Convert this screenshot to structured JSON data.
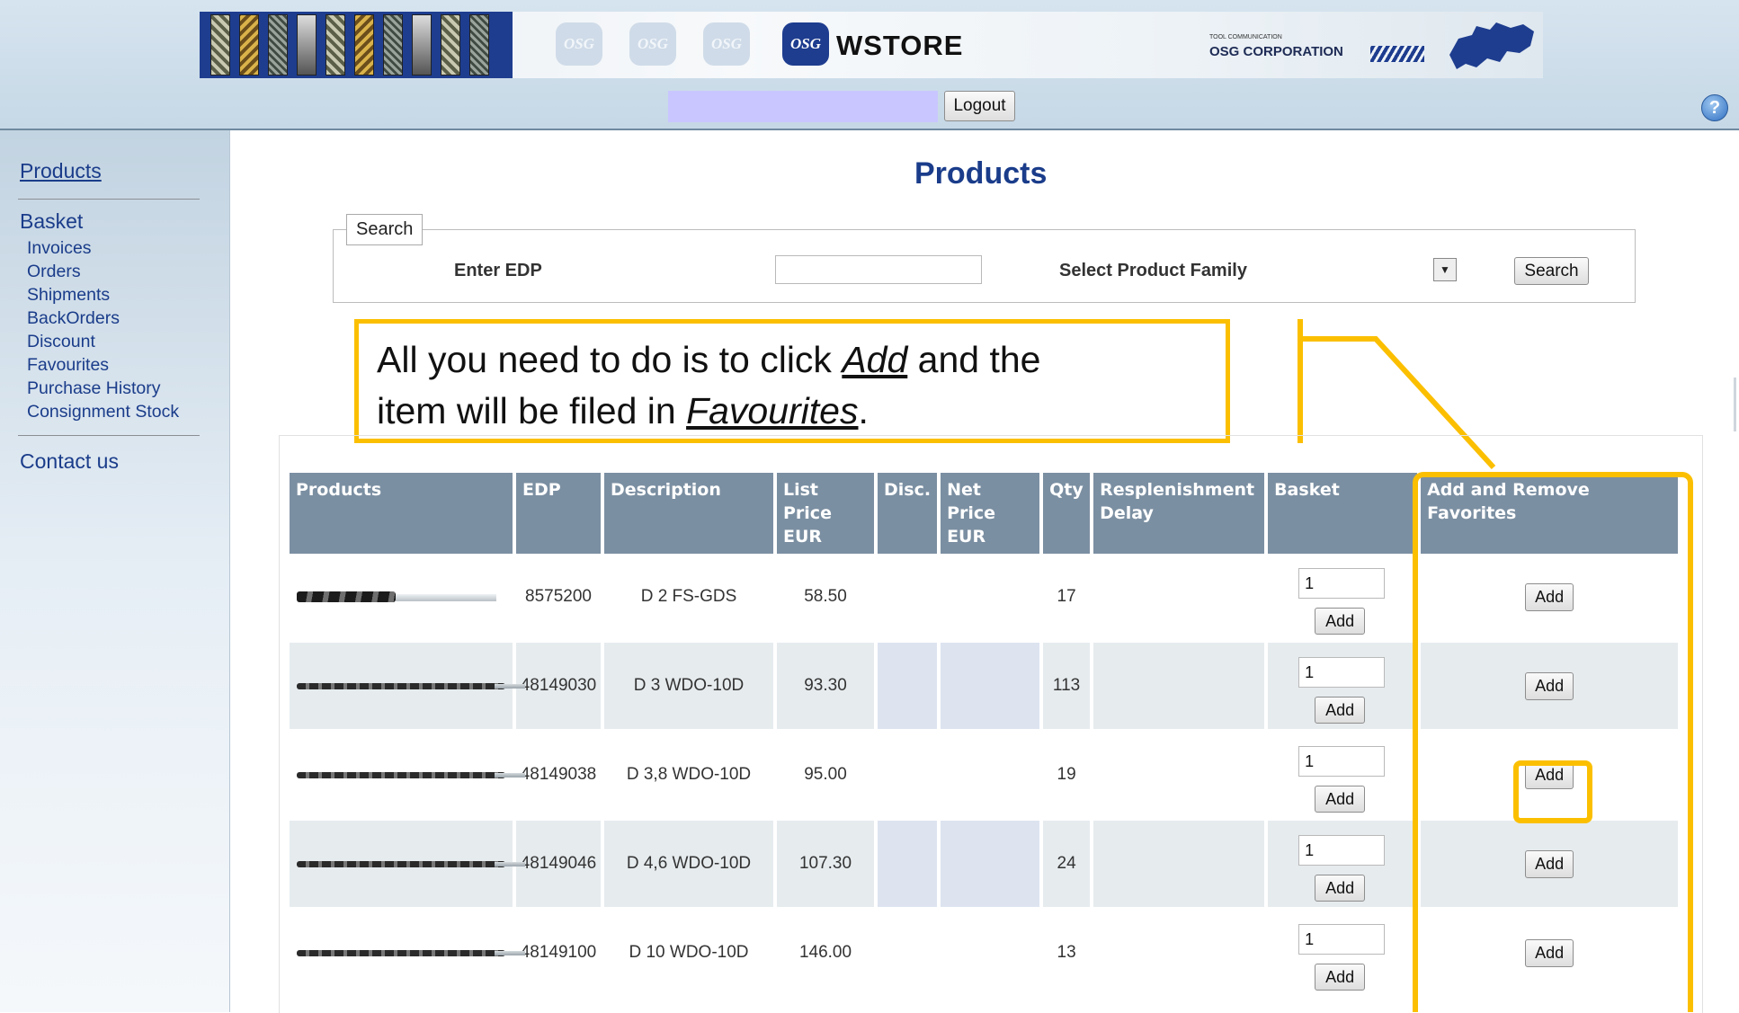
{
  "header": {
    "logo_text": "WSTORE",
    "logo_mark": "OSG",
    "corp_small": "TOOL COMMUNICATION",
    "corp_name": "OSG CORPORATION",
    "logout_label": "Logout",
    "help_icon": "help-icon",
    "help_label": "?"
  },
  "sidebar": {
    "products": "Products",
    "basket": "Basket",
    "items": [
      "Invoices",
      "Orders",
      "Shipments",
      "BackOrders",
      "Discount",
      "Favourites",
      "Purchase History",
      "Consignment Stock"
    ],
    "contact": "Contact us"
  },
  "main": {
    "title": "Products",
    "search": {
      "legend": "Search",
      "edp_label": "Enter EDP",
      "edp_value": "",
      "family_label": "Select Product Family",
      "family_value": "",
      "button": "Search"
    },
    "callout": {
      "line1_pre": "All you need to do is to click ",
      "line1_link": "Add",
      "line1_post": " and the",
      "line2_pre": "item will be filed in ",
      "line2_link": "Favourites",
      "line2_post": "."
    },
    "table": {
      "columns": {
        "products": "Products",
        "edp": "EDP",
        "description": "Description",
        "list_price": [
          "List",
          "Price",
          "EUR"
        ],
        "disc": "Disc.",
        "net_price": [
          "Net",
          "Price",
          "EUR"
        ],
        "qty": "Qty",
        "replenishment": [
          "Resplenishment",
          "Delay"
        ],
        "basket": "Basket",
        "favorites": [
          "Add and Remove",
          "Favorites"
        ]
      },
      "rows": [
        {
          "edp": "8575200",
          "description": "D 2 FS-GDS",
          "list_price": "58.50",
          "disc": "",
          "net_price": "",
          "qty": "17",
          "delay": "",
          "basket_qty": "1",
          "basket_add": "Add",
          "fav_add": "Add"
        },
        {
          "edp": "48149030",
          "description": "D 3 WDO-10D",
          "list_price": "93.30",
          "disc": "",
          "net_price": "",
          "qty": "113",
          "delay": "",
          "basket_qty": "1",
          "basket_add": "Add",
          "fav_add": "Add"
        },
        {
          "edp": "48149038",
          "description": "D 3,8 WDO-10D",
          "list_price": "95.00",
          "disc": "",
          "net_price": "",
          "qty": "19",
          "delay": "",
          "basket_qty": "1",
          "basket_add": "Add",
          "fav_add": "Add"
        },
        {
          "edp": "48149046",
          "description": "D 4,6 WDO-10D",
          "list_price": "107.30",
          "disc": "",
          "net_price": "",
          "qty": "24",
          "delay": "",
          "basket_qty": "1",
          "basket_add": "Add",
          "fav_add": "Add"
        },
        {
          "edp": "48149100",
          "description": "D 10 WDO-10D",
          "list_price": "146.00",
          "disc": "",
          "net_price": "",
          "qty": "13",
          "delay": "",
          "basket_qty": "1",
          "basket_add": "Add",
          "fav_add": "Add"
        }
      ]
    }
  },
  "colors": {
    "header_bg": "#c6d8e6",
    "link": "#1a3c8a",
    "table_header": "#7b8fa2",
    "row_alt": "#e6ebee",
    "highlight": "#fbbf00"
  }
}
